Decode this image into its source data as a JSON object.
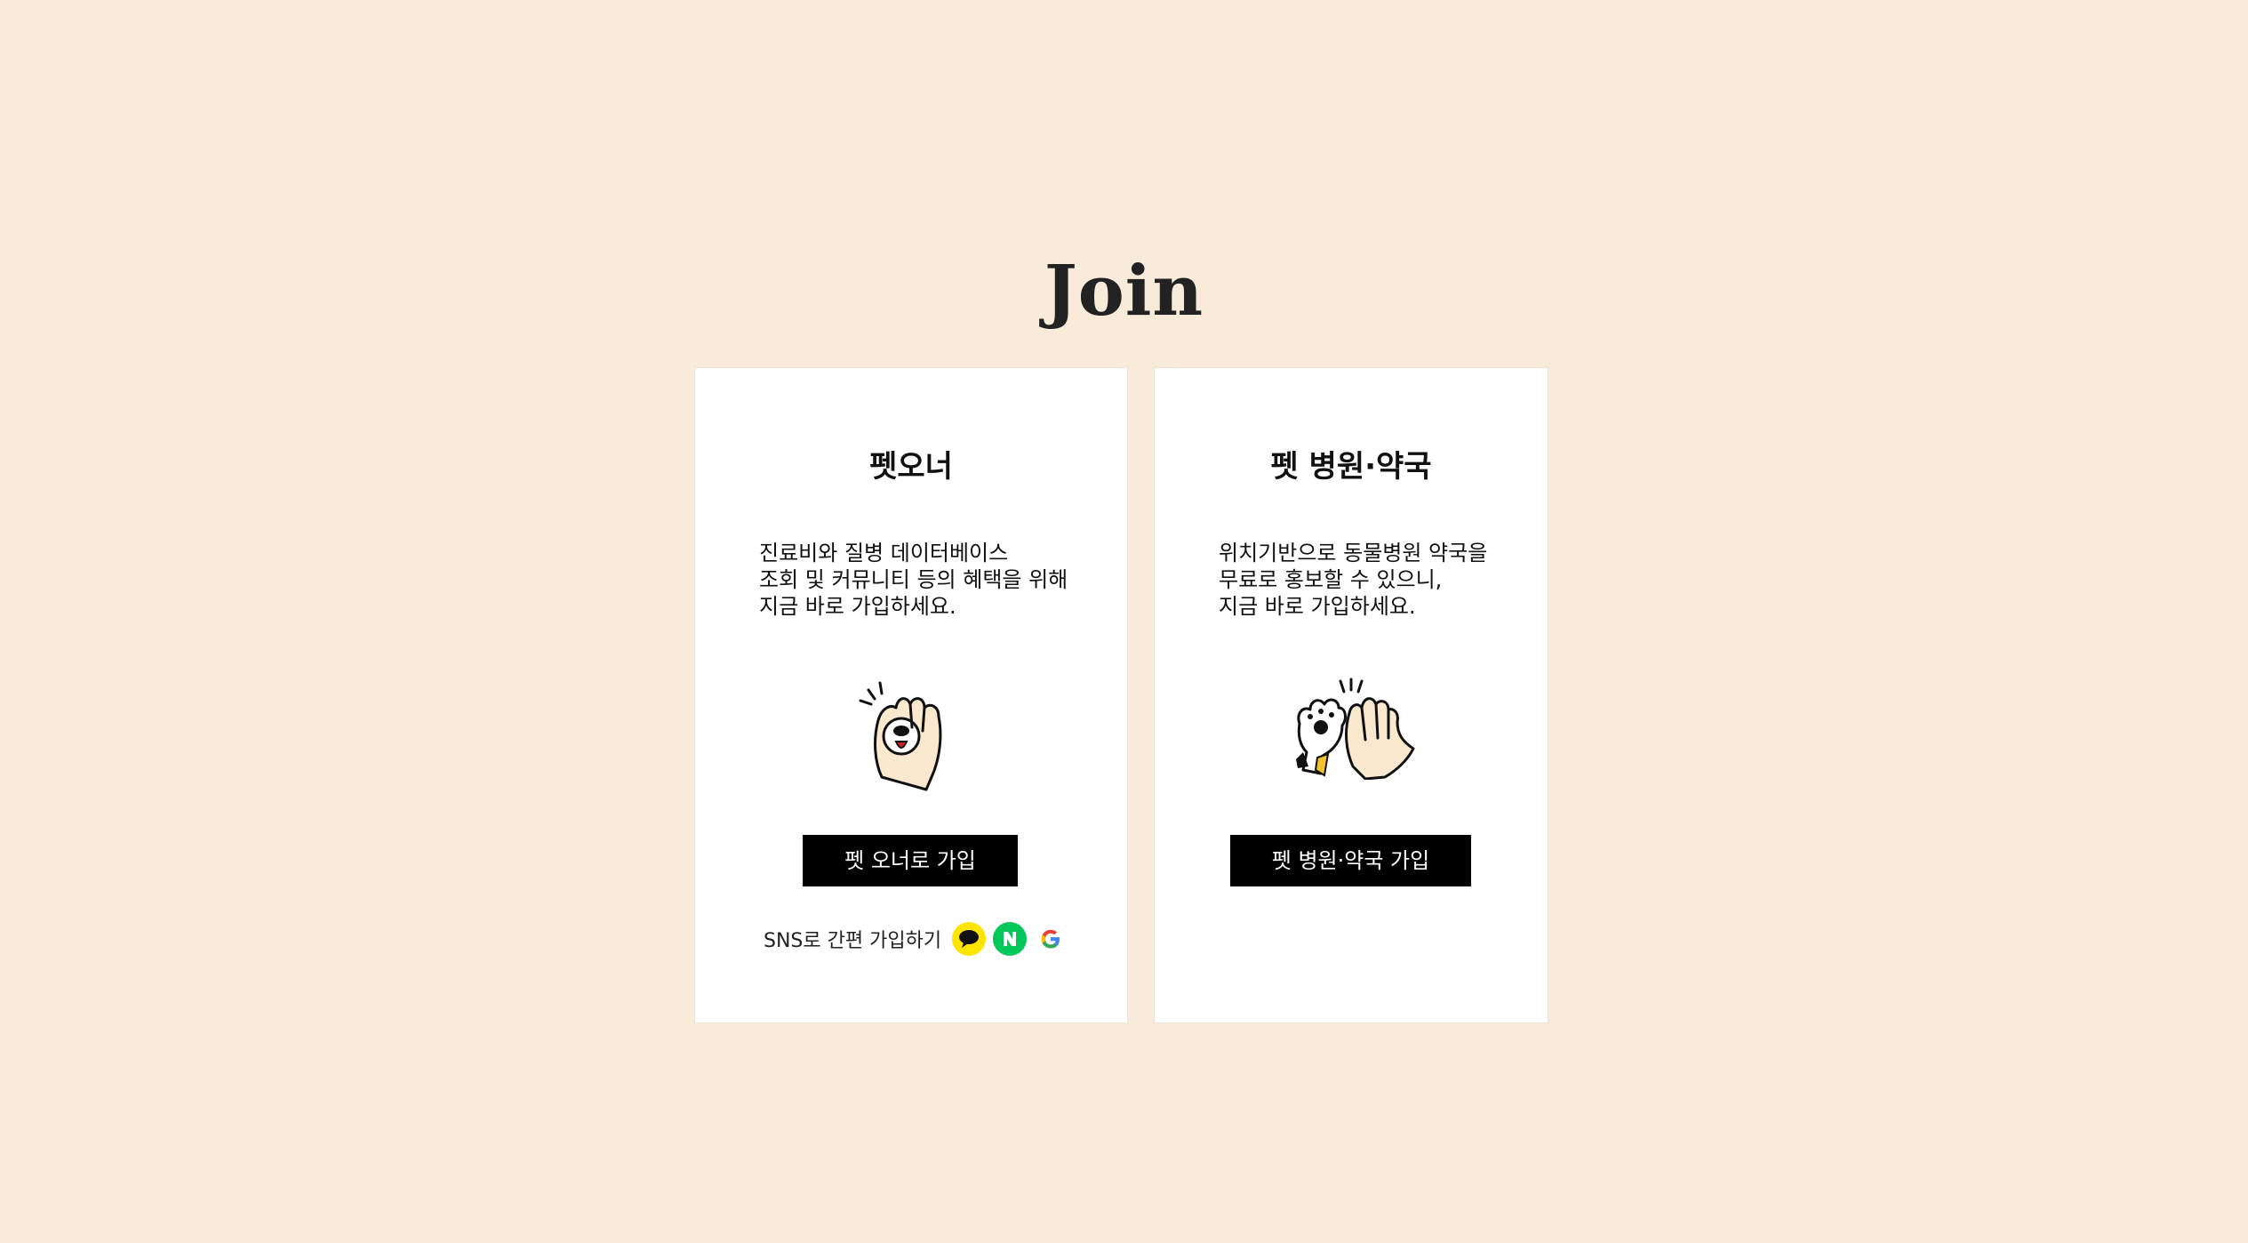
{
  "page": {
    "title": "Join"
  },
  "cards": {
    "owner": {
      "title": "펫오너",
      "description": [
        "진료비와 질병 데이터베이스",
        "조회 및 커뮤니티 등의 혜택을 위해",
        "지금 바로 가입하세요."
      ],
      "button_label": "펫 오너로 가입",
      "sns_label": "SNS로 간편 가입하기",
      "sns_icons": [
        "kakao-icon",
        "naver-icon",
        "google-icon"
      ],
      "illustration": "paw-handshake-icon"
    },
    "hospital": {
      "title": "펫 병원·약국",
      "description": [
        "위치기반으로 동물병원 약국을",
        "무료로 홍보할 수 있으니,",
        "지금 바로 가입하세요."
      ],
      "button_label": "펫 병원·약국 가입",
      "illustration": "high-five-icon"
    }
  },
  "colors": {
    "background": "#f8ebd9",
    "card": "#ffffff",
    "button": "#000000",
    "kakao": "#fee500",
    "naver": "#03c75a"
  }
}
